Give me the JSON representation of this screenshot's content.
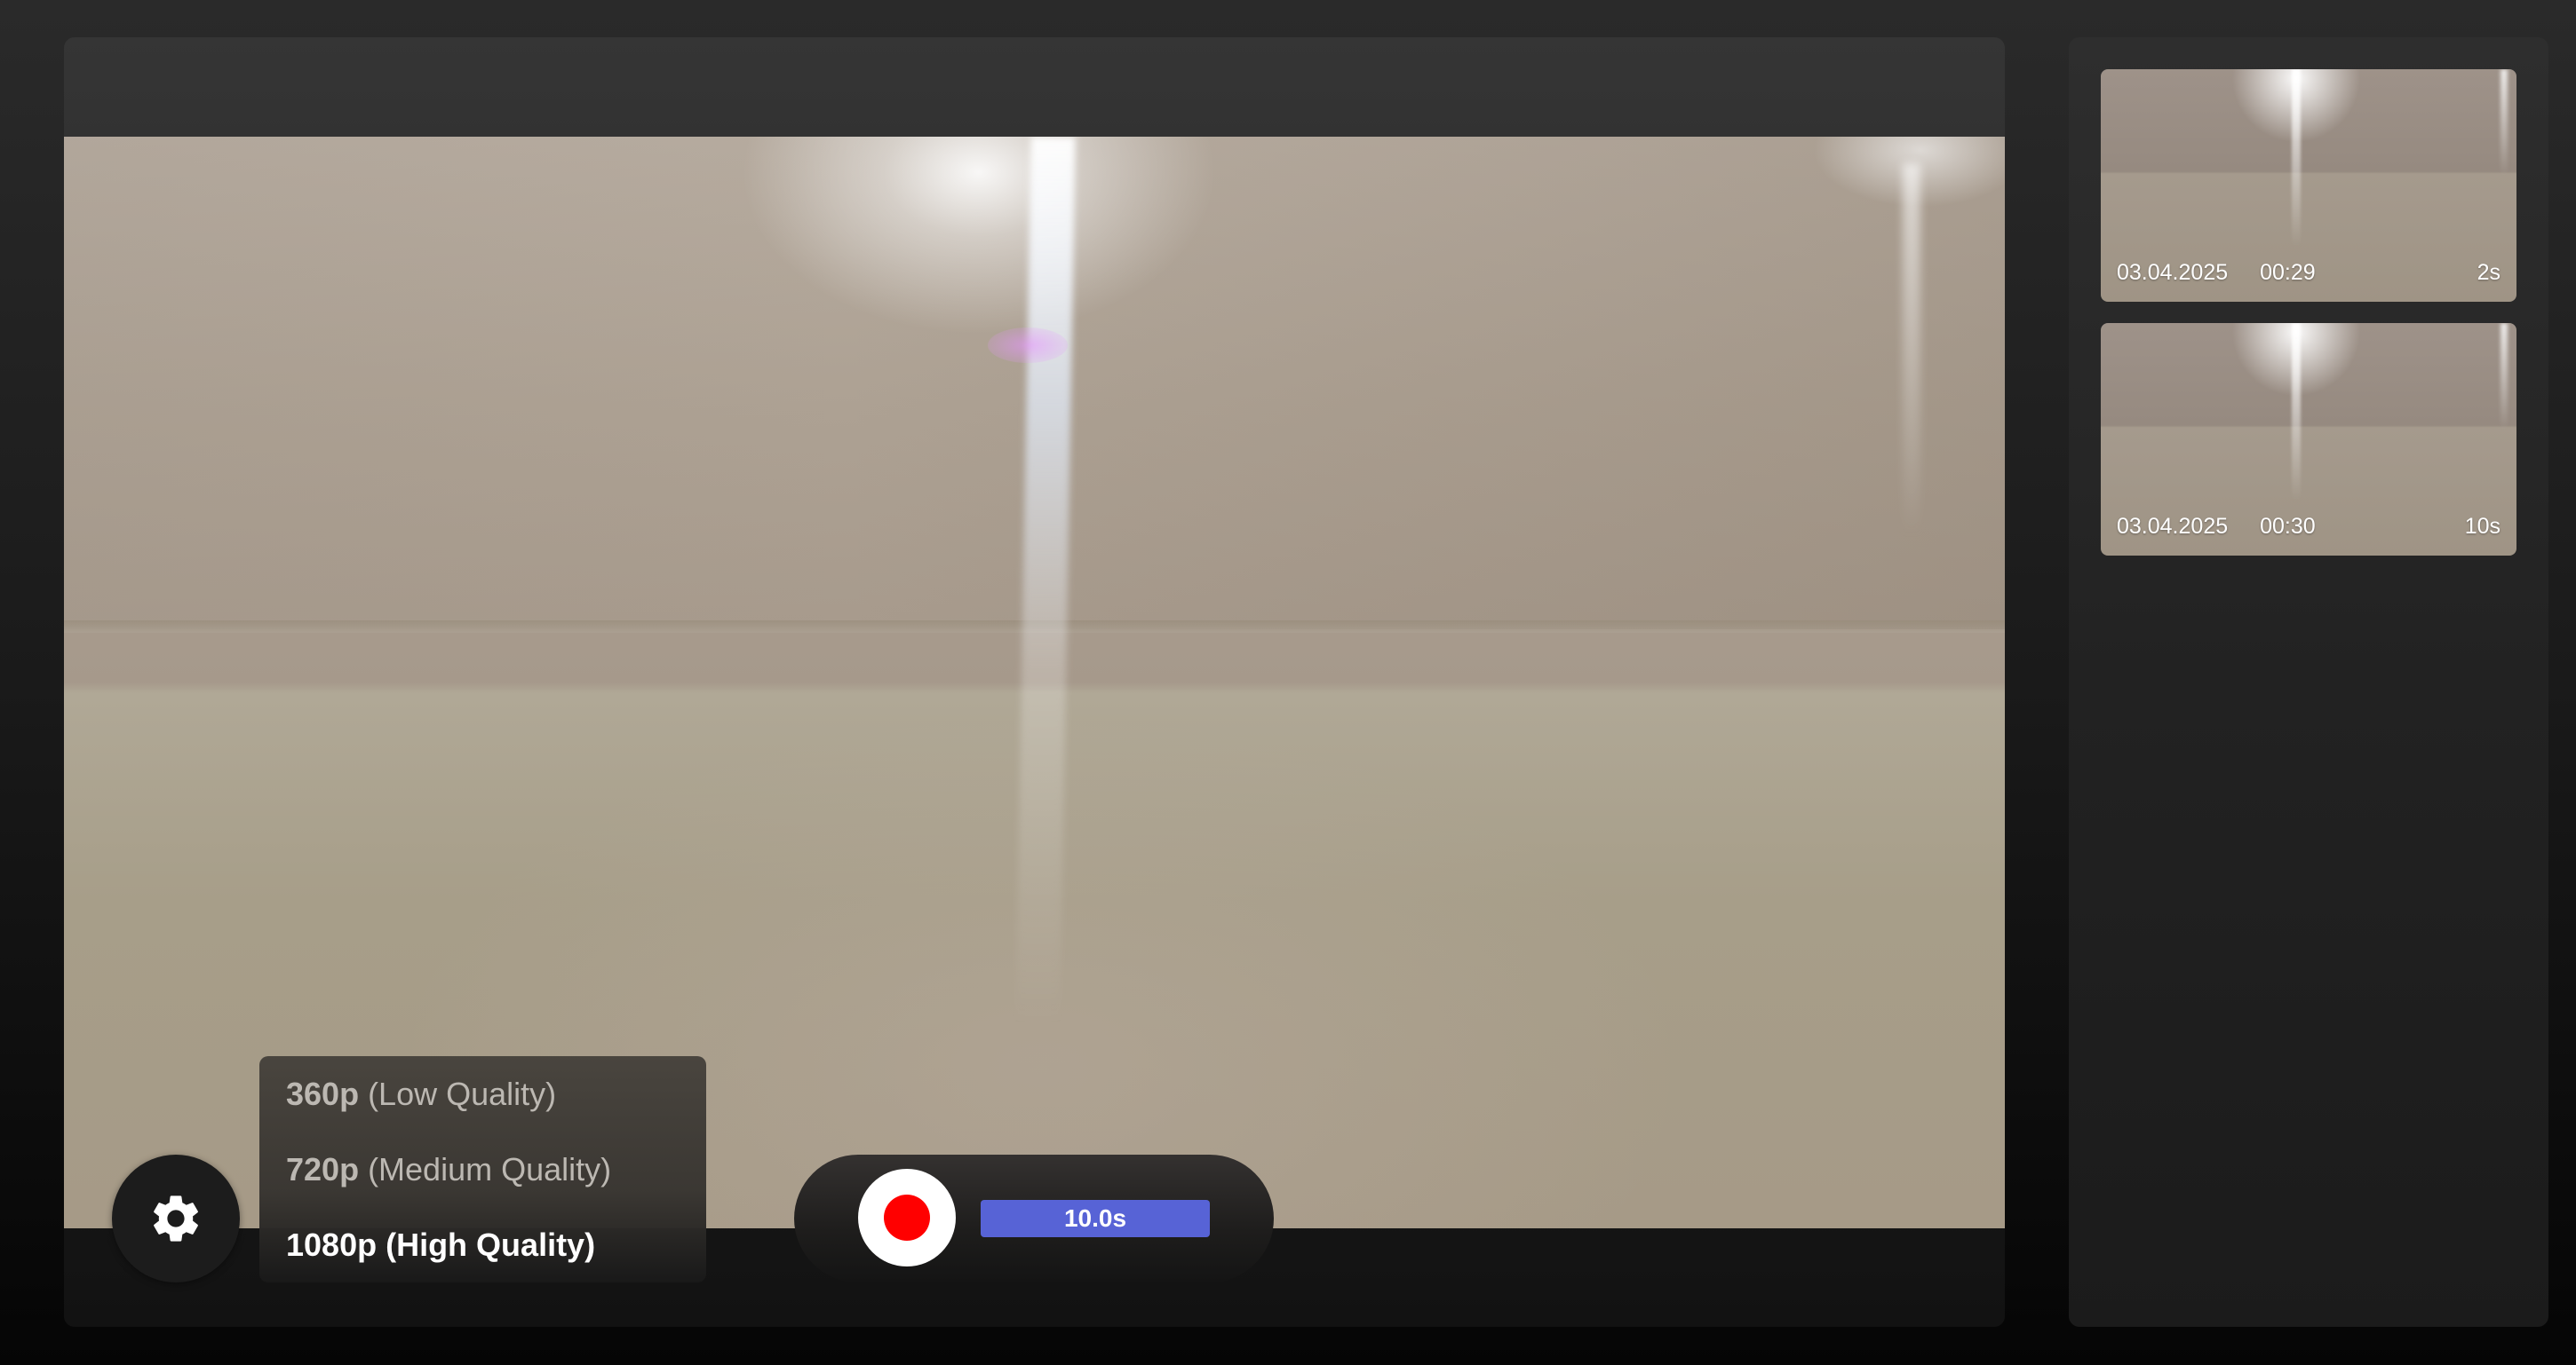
{
  "quality_menu": {
    "options": [
      {
        "res": "360p",
        "desc": "(Low Quality)",
        "selected": false
      },
      {
        "res": "720p",
        "desc": "(Medium Quality)",
        "selected": false
      },
      {
        "res": "1080p",
        "desc": "(High Quality)",
        "selected": true
      }
    ]
  },
  "recorder": {
    "timer_label": "10.0s",
    "record_color": "#ff0000",
    "timer_color": "#5763d6"
  },
  "icons": {
    "settings": "gear-icon",
    "record": "record-dot-icon"
  },
  "clips": [
    {
      "date": "03.04.2025",
      "time": "00:29",
      "duration": "2s"
    },
    {
      "date": "03.04.2025",
      "time": "00:30",
      "duration": "10s"
    }
  ]
}
